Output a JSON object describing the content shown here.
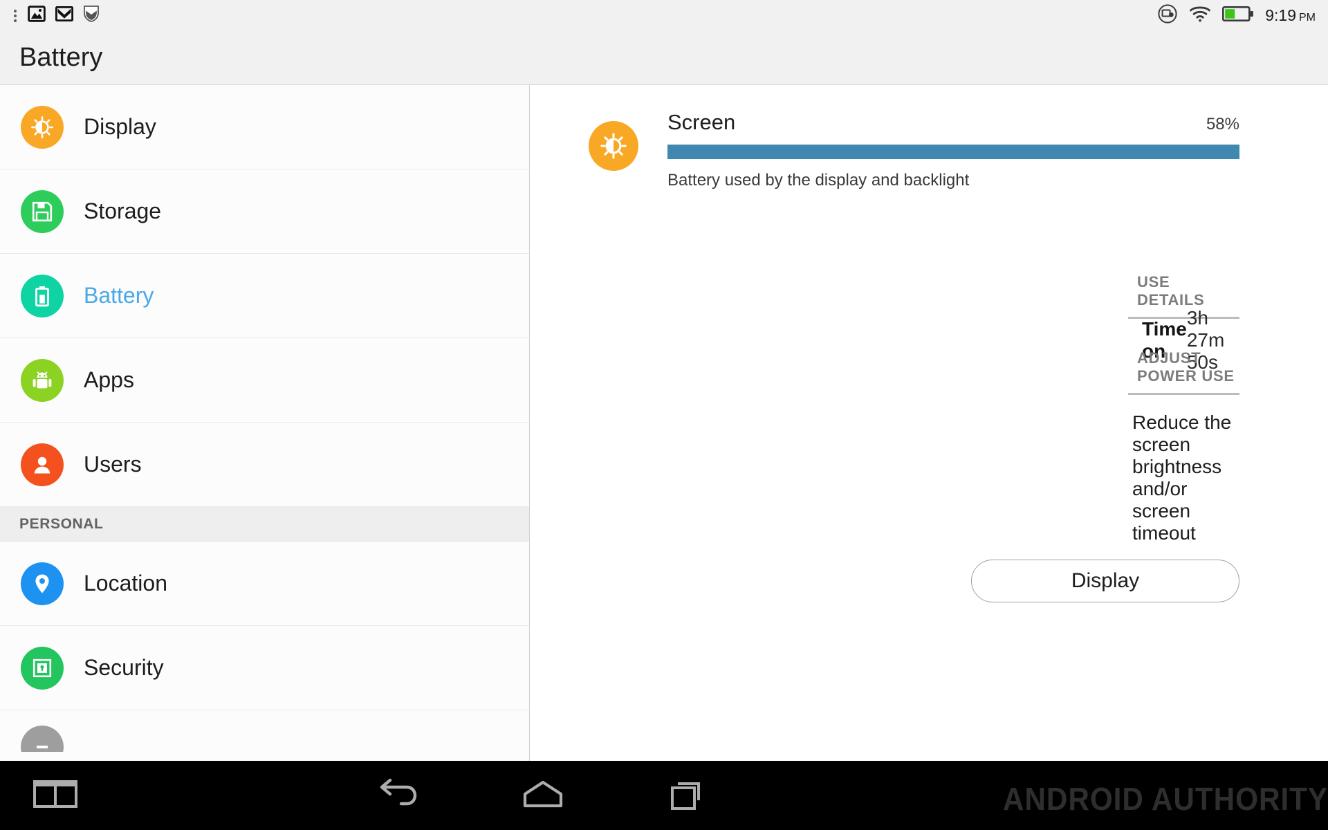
{
  "status_bar": {
    "left_icons": [
      {
        "name": "overflow-menu-icon",
        "glyph": "dots"
      },
      {
        "name": "photos-notification-icon",
        "glyph": "image"
      },
      {
        "name": "gmail-notification-icon",
        "glyph": "gmail"
      },
      {
        "name": "security-shield-notification-icon",
        "glyph": "shield"
      }
    ],
    "right_icons": [
      {
        "name": "cast-screen-icon",
        "glyph": "cast"
      },
      {
        "name": "wifi-icon",
        "glyph": "wifi"
      },
      {
        "name": "battery-status-icon",
        "glyph": "battery",
        "level_pct": 42,
        "color": "#3ec417"
      }
    ],
    "time": "9:19",
    "time_period": "PM"
  },
  "header": {
    "title": "Battery"
  },
  "sidebar": {
    "items": [
      {
        "label": "Display",
        "icon": "brightness-icon",
        "color": "#f9a825",
        "selected": false
      },
      {
        "label": "Storage",
        "icon": "save-disk-icon",
        "color": "#2ecc5b",
        "selected": false
      },
      {
        "label": "Battery",
        "icon": "battery-icon",
        "color": "#0ed3a3",
        "selected": true
      },
      {
        "label": "Apps",
        "icon": "android-robot-icon",
        "color": "#8bd222",
        "selected": false
      },
      {
        "label": "Users",
        "icon": "person-icon",
        "color": "#f4511e",
        "selected": false
      }
    ],
    "section_label": "PERSONAL",
    "personal_items": [
      {
        "label": "Location",
        "icon": "map-pin-icon",
        "color": "#1e92f0",
        "selected": false
      },
      {
        "label": "Security",
        "icon": "lock-shield-icon",
        "color": "#22c55e",
        "selected": false
      }
    ],
    "partial_item": {
      "label": "",
      "icon": "generic-settings-icon",
      "color": "#9e9e9e"
    },
    "selected_color": "#4aa8e8"
  },
  "detail": {
    "app": {
      "name": "Screen",
      "percent": "58%",
      "percent_value": 58,
      "icon": "brightness-icon",
      "icon_color": "#f9a825",
      "bar_color": "#4088b0",
      "bar_fill_pct": 100,
      "subtitle": "Battery used by the display and backlight"
    },
    "use_details": {
      "title": "USE DETAILS",
      "rows": [
        {
          "key": "Time on",
          "value": "3h 27m 50s"
        }
      ]
    },
    "adjust_power_use": {
      "title": "ADJUST POWER USE",
      "description": "Reduce the screen brightness and/or screen timeout",
      "button_label": "Display"
    }
  },
  "navbar": {
    "buttons": [
      {
        "name": "split-screen-button",
        "icon": "split-screen-icon"
      },
      {
        "name": "back-button",
        "icon": "back-arrow-icon"
      },
      {
        "name": "home-button",
        "icon": "home-icon"
      },
      {
        "name": "recents-button",
        "icon": "recents-icon"
      }
    ],
    "watermark": "ANDROID AUTHORITY"
  }
}
